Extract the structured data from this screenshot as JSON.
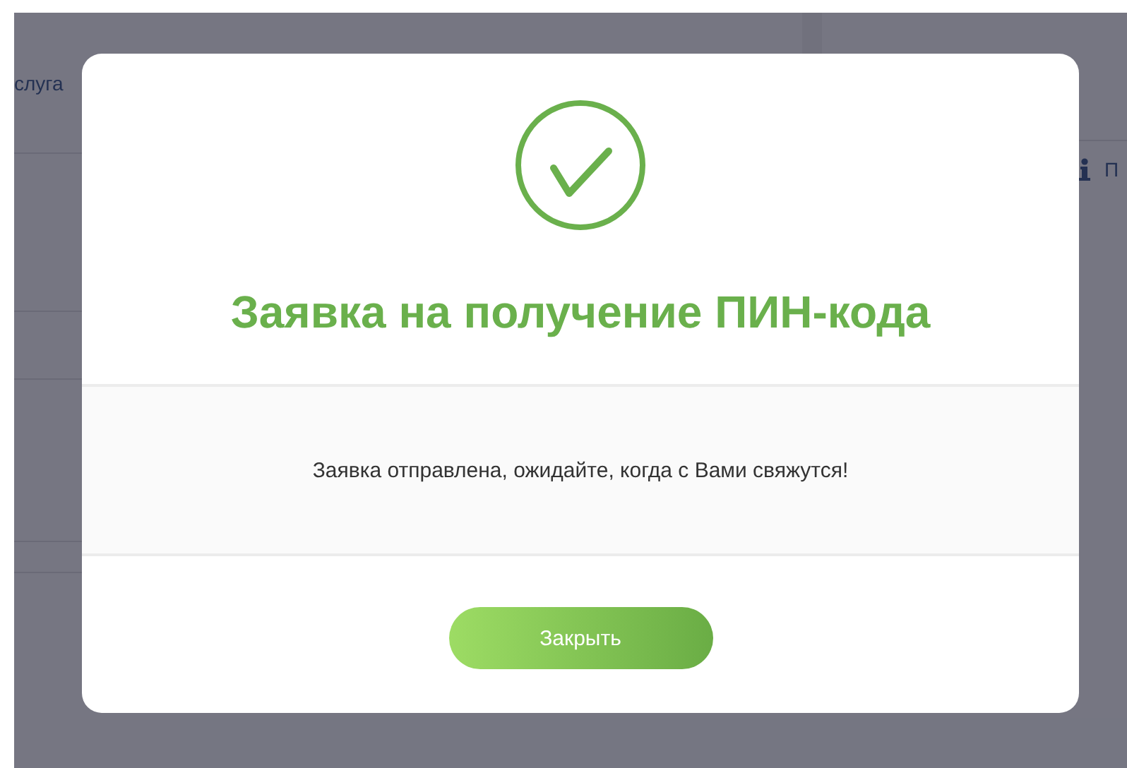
{
  "background": {
    "nav_link": "слуга",
    "side_link": "П"
  },
  "dialog": {
    "title": "Заявка на получение ПИН-кода",
    "message": "Заявка отправлена, ожидайте, когда с Вами свяжутся!",
    "button": "Закрыть"
  }
}
